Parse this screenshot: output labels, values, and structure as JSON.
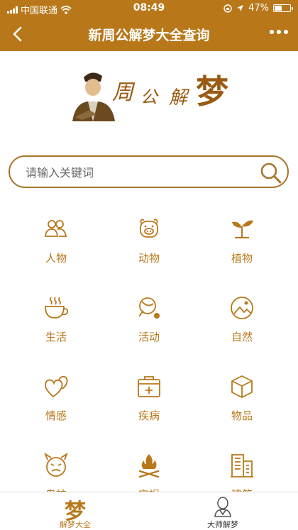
{
  "status_bar": {
    "carrier": "中国联通",
    "time": "08:49",
    "battery_text": "47%",
    "battery_level": 0.47
  },
  "nav": {
    "title": "新周公解梦大全查询",
    "back_icon": "chevron-left-icon",
    "more_icon": "more-dots-icon"
  },
  "logo": {
    "chars": [
      "周",
      "公",
      "解",
      "梦"
    ]
  },
  "search": {
    "placeholder": "请输入关键词",
    "value": "",
    "icon": "search-icon"
  },
  "categories": [
    {
      "label": "人物",
      "icon": "people-icon"
    },
    {
      "label": "动物",
      "icon": "pig-face-icon"
    },
    {
      "label": "植物",
      "icon": "sprout-icon"
    },
    {
      "label": "生活",
      "icon": "steaming-cup-icon"
    },
    {
      "label": "活动",
      "icon": "ping-pong-icon"
    },
    {
      "label": "自然",
      "icon": "landscape-icon"
    },
    {
      "label": "情感",
      "icon": "hearts-icon"
    },
    {
      "label": "疾病",
      "icon": "medical-kit-icon"
    },
    {
      "label": "物品",
      "icon": "box-icon"
    },
    {
      "label": "鬼神",
      "icon": "devil-face-icon"
    },
    {
      "label": "灾祸",
      "icon": "fire-icon"
    },
    {
      "label": "建筑",
      "icon": "building-icon"
    }
  ],
  "tabbar": {
    "tabs": [
      {
        "glyph": "梦",
        "label": "解梦大全",
        "active": true
      },
      {
        "label": "大师解梦",
        "active": false,
        "icon": "monk-icon"
      }
    ]
  },
  "colors": {
    "brand": "#b8781a",
    "search_border": "#a8762b",
    "tab_inactive": "#333333"
  }
}
